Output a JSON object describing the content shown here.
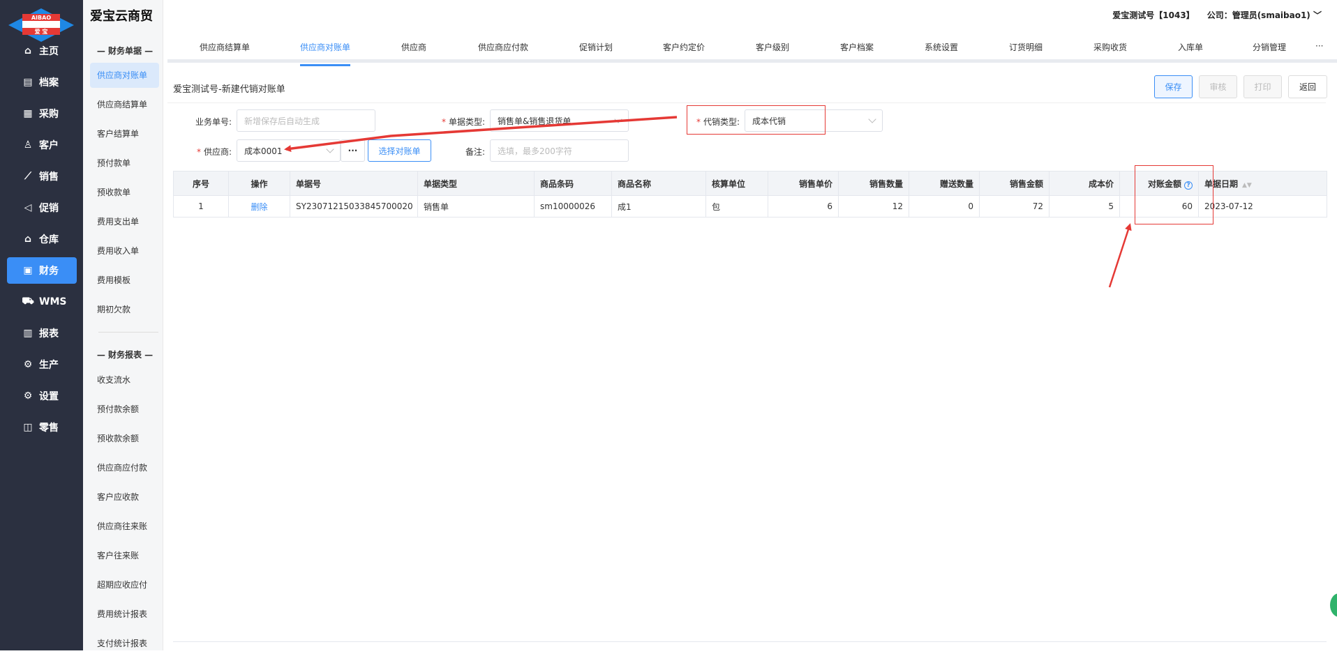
{
  "app": {
    "title": "爱宝云商贸",
    "logo_text_top": "AIBAO",
    "logo_text_bottom": "爱 宝"
  },
  "header": {
    "account": "爱宝测试号【1043】",
    "company": "公司：管理员(smaibao1)"
  },
  "leftnav": [
    {
      "label": "主页",
      "icon": "home-icon"
    },
    {
      "label": "档案",
      "icon": "archive-icon"
    },
    {
      "label": "采购",
      "icon": "purchase-icon"
    },
    {
      "label": "客户",
      "icon": "user-icon"
    },
    {
      "label": "销售",
      "icon": "chart-line-icon"
    },
    {
      "label": "促销",
      "icon": "megaphone-icon"
    },
    {
      "label": "仓库",
      "icon": "warehouse-icon"
    },
    {
      "label": "财务",
      "icon": "finance-icon",
      "active": true
    },
    {
      "label": "WMS",
      "icon": "truck-icon"
    },
    {
      "label": "报表",
      "icon": "bar-chart-icon"
    },
    {
      "label": "生产",
      "icon": "production-icon"
    },
    {
      "label": "设置",
      "icon": "gear-icon"
    },
    {
      "label": "零售",
      "icon": "bag-icon"
    }
  ],
  "subnav": {
    "section1": "— 财务单据 —",
    "items1": [
      "供应商对账单",
      "供应商结算单",
      "客户结算单",
      "预付款单",
      "预收款单",
      "费用支出单",
      "费用收入单",
      "费用模板",
      "期初欠款"
    ],
    "section2": "— 财务报表 —",
    "items2": [
      "收支流水",
      "预付款余额",
      "预收款余额",
      "供应商应付款",
      "客户应收款",
      "供应商往来账",
      "客户往来账",
      "超期应收应付",
      "费用统计报表",
      "支付统计报表"
    ]
  },
  "tabs": [
    "供应商结算单",
    "供应商对账单",
    "供应商",
    "供应商应付款",
    "促销计划",
    "客户约定价",
    "客户级别",
    "客户档案",
    "系统设置",
    "订货明细",
    "采购收货",
    "入库单",
    "分销管理",
    "···"
  ],
  "active_tab": "供应商对账单",
  "page": {
    "title": "爱宝测试号-新建代销对账单",
    "buttons": {
      "save": "保存",
      "audit": "审核",
      "print": "打印",
      "back": "返回"
    }
  },
  "form": {
    "bizno_label": "业务单号:",
    "bizno_placeholder": "新增保存后自动生成",
    "doctype_label": "单据类型:",
    "doctype_value": "销售单&销售退货单",
    "constype_label": "代销类型:",
    "constype_value": "成本代销",
    "supplier_label": "供应商:",
    "supplier_value": "成本0001",
    "more_btn": "···",
    "select_btn": "选择对账单",
    "remark_label": "备注:",
    "remark_placeholder": "选填，最多200字符"
  },
  "table": {
    "headers": [
      "序号",
      "操作",
      "单据号",
      "单据类型",
      "商品条码",
      "商品名称",
      "核算单位",
      "销售单价",
      "销售数量",
      "赠送数量",
      "销售金额",
      "成本价",
      "对账金额",
      "单据日期"
    ],
    "rows": [
      [
        "1",
        "删除",
        "SY23071215033845700020",
        "销售单",
        "sm10000026",
        "成1",
        "包",
        "6",
        "12",
        "0",
        "72",
        "5",
        "60",
        "2023-07-12"
      ]
    ]
  },
  "colors": {
    "accent": "#3a8ef6",
    "nav_bg": "#2b3040",
    "annotation_red": "#e53935"
  }
}
